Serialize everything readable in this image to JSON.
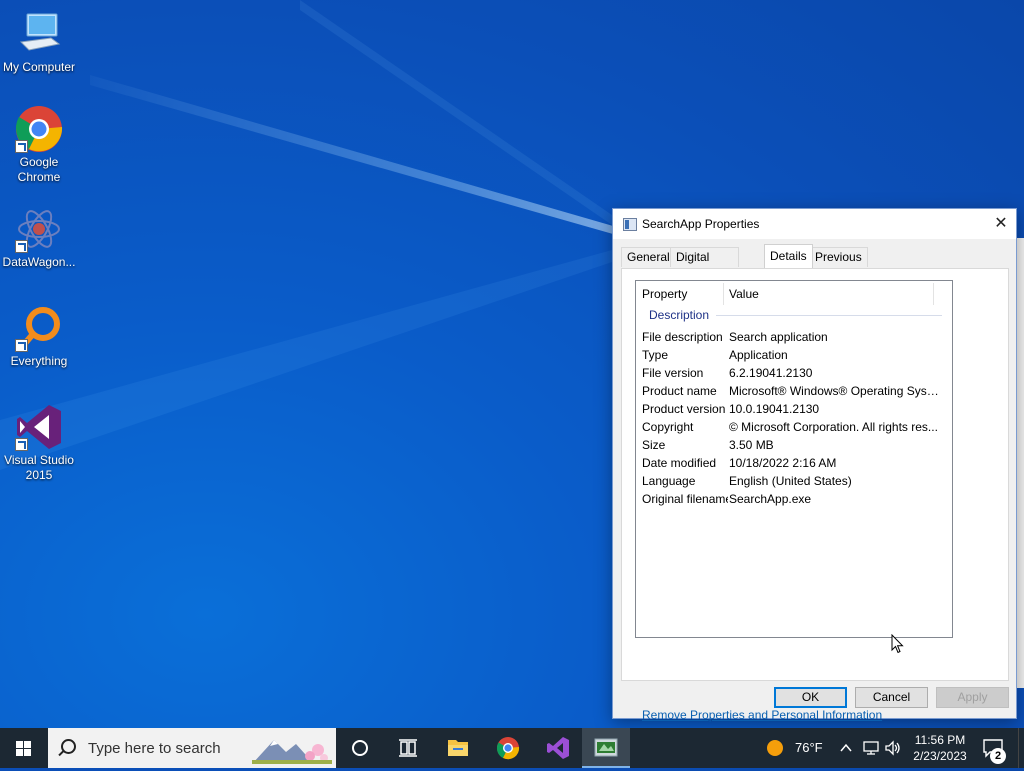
{
  "desktop": {
    "icons": [
      {
        "label": "My Computer"
      },
      {
        "label": "Google Chrome"
      },
      {
        "label": "DataWagon..."
      },
      {
        "label": "Everything"
      },
      {
        "label": "Visual Studio 2015"
      }
    ]
  },
  "dialog": {
    "title": "SearchApp Properties",
    "close_glyph": "✕",
    "tabs": [
      {
        "label": "General"
      },
      {
        "label": "Digital Signatures"
      },
      {
        "label": "Details",
        "active": true
      },
      {
        "label": "Previous Versions"
      }
    ],
    "columns": {
      "property": "Property",
      "value": "Value"
    },
    "group": "Description",
    "rows": [
      {
        "k": "File description",
        "v": "Search application"
      },
      {
        "k": "Type",
        "v": "Application"
      },
      {
        "k": "File version",
        "v": "6.2.19041.2130"
      },
      {
        "k": "Product name",
        "v": "Microsoft® Windows® Operating Syst..."
      },
      {
        "k": "Product version",
        "v": "10.0.19041.2130"
      },
      {
        "k": "Copyright",
        "v": "© Microsoft Corporation. All rights res..."
      },
      {
        "k": "Size",
        "v": "3.50 MB"
      },
      {
        "k": "Date modified",
        "v": "10/18/2022 2:16 AM"
      },
      {
        "k": "Language",
        "v": "English (United States)"
      },
      {
        "k": "Original filename",
        "v": "SearchApp.exe"
      }
    ],
    "remove_link": "Remove Properties and Personal Information",
    "ok_label": "OK",
    "cancel_label": "Cancel",
    "apply_label": "Apply"
  },
  "taskbar": {
    "search_placeholder": "Type here to search",
    "weather": "76°F",
    "time": "11:56 PM",
    "date": "2/23/2023",
    "notification_count": "2"
  },
  "colors": {
    "desktop_bg": "#0b5bc8",
    "taskbar_bg": "#1c2833",
    "accent": "#0078d7",
    "link": "#0a5fb0",
    "group_text": "#1e3287"
  }
}
